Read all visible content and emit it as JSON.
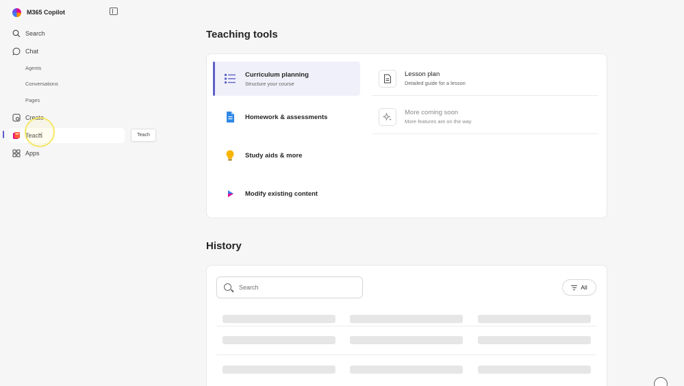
{
  "app": {
    "title": "M365 Copilot"
  },
  "sidebar": {
    "items": [
      {
        "label": "Search",
        "icon": "search-icon"
      },
      {
        "label": "Chat",
        "icon": "chat-icon"
      },
      {
        "label": "Create",
        "icon": "create-icon"
      },
      {
        "label": "Teach",
        "icon": "teach-icon"
      },
      {
        "label": "Apps",
        "icon": "apps-icon"
      }
    ],
    "chat_subitems": [
      "Agents",
      "Conversations",
      "Pages"
    ],
    "tooltip": "Teach"
  },
  "teaching_tools": {
    "title": "Teaching tools",
    "items": [
      {
        "title": "Curriculum planning",
        "subtitle": "Structure your course",
        "icon": "list-icon"
      },
      {
        "title": "Homework & assessments",
        "icon": "document-icon"
      },
      {
        "title": "Study aids & more",
        "icon": "lightbulb-icon"
      },
      {
        "title": "Modify existing content",
        "icon": "edit-icon"
      }
    ],
    "options": [
      {
        "title": "Lesson plan",
        "subtitle": "Detailed guide for a lesson",
        "icon": "page-icon"
      },
      {
        "title": "More coming soon",
        "subtitle": "More features are on the way",
        "icon": "sparkle-icon"
      }
    ]
  },
  "history": {
    "title": "History",
    "search_placeholder": "Search",
    "filter_label": "All"
  },
  "colors": {
    "accent": "#5b5fc7",
    "background": "#f6f6f6",
    "card": "#ffffff"
  }
}
